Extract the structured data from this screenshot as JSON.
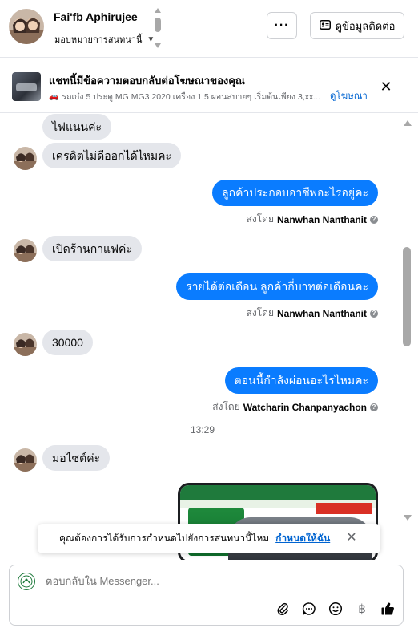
{
  "header": {
    "contact_name": "Fai'fb Aphirujee",
    "assign_label": "มอบหมายการสนทนานี้",
    "more_label": "···",
    "contact_info_label": "ดูข้อมูลติดต่อ"
  },
  "ad_banner": {
    "title": "แชทนี้มีข้อความตอบกลับต่อโฆษณาของคุณ",
    "description": "รถเก๋ง 5 ประตู MG MG3 2020 เครื่อง 1.5 ผ่อนสบายๆ เริ่มต้นเพียง 3,xx...",
    "link_label": "ดูโฆษณา"
  },
  "messages": [
    {
      "id": "m1",
      "direction": "in",
      "text": "ไฟแนนค่ะ"
    },
    {
      "id": "m2",
      "direction": "in",
      "text": "เครดิตไม่ดีออกได้ไหมคะ"
    },
    {
      "id": "m3",
      "direction": "out",
      "text": "ลูกค้าประกอบอาชีพอะไรอยู่คะ",
      "sent_by_label": "ส่งโดย",
      "sender": "Nanwhan Nanthanit"
    },
    {
      "id": "m4",
      "direction": "in",
      "text": "เปิดร้านกาแฟค่ะ"
    },
    {
      "id": "m5",
      "direction": "out",
      "text": "รายได้ต่อเดือน ลูกค้ากี่บาทต่อเดือนคะ",
      "sent_by_label": "ส่งโดย",
      "sender": "Nanwhan Nanthanit"
    },
    {
      "id": "m6",
      "direction": "in",
      "text": "30000"
    },
    {
      "id": "m7",
      "direction": "out",
      "text": "ตอนนี้กำลังผ่อนอะไรไหมคะ",
      "sent_by_label": "ส่งโดย",
      "sender": "Watcharin Chanpanyachon"
    },
    {
      "id": "m8",
      "direction": "in",
      "text": "มอไซต์ค่ะ"
    }
  ],
  "timestamp": "13:29",
  "toast": {
    "text": "คุณต้องการได้รับการกำหนดไปยังการสนทนานี้ไหม",
    "link_label": "กำหนดให้ฉัน"
  },
  "composer": {
    "placeholder": "ตอบกลับใน Messenger...",
    "tools": [
      "attach-icon",
      "saved-reply-icon",
      "emoji-icon",
      "baht-icon",
      "like-icon"
    ]
  },
  "colors": {
    "outgoing_bubble": "#0a7cff",
    "incoming_bubble": "#e4e6eb",
    "link": "#0064d1"
  }
}
